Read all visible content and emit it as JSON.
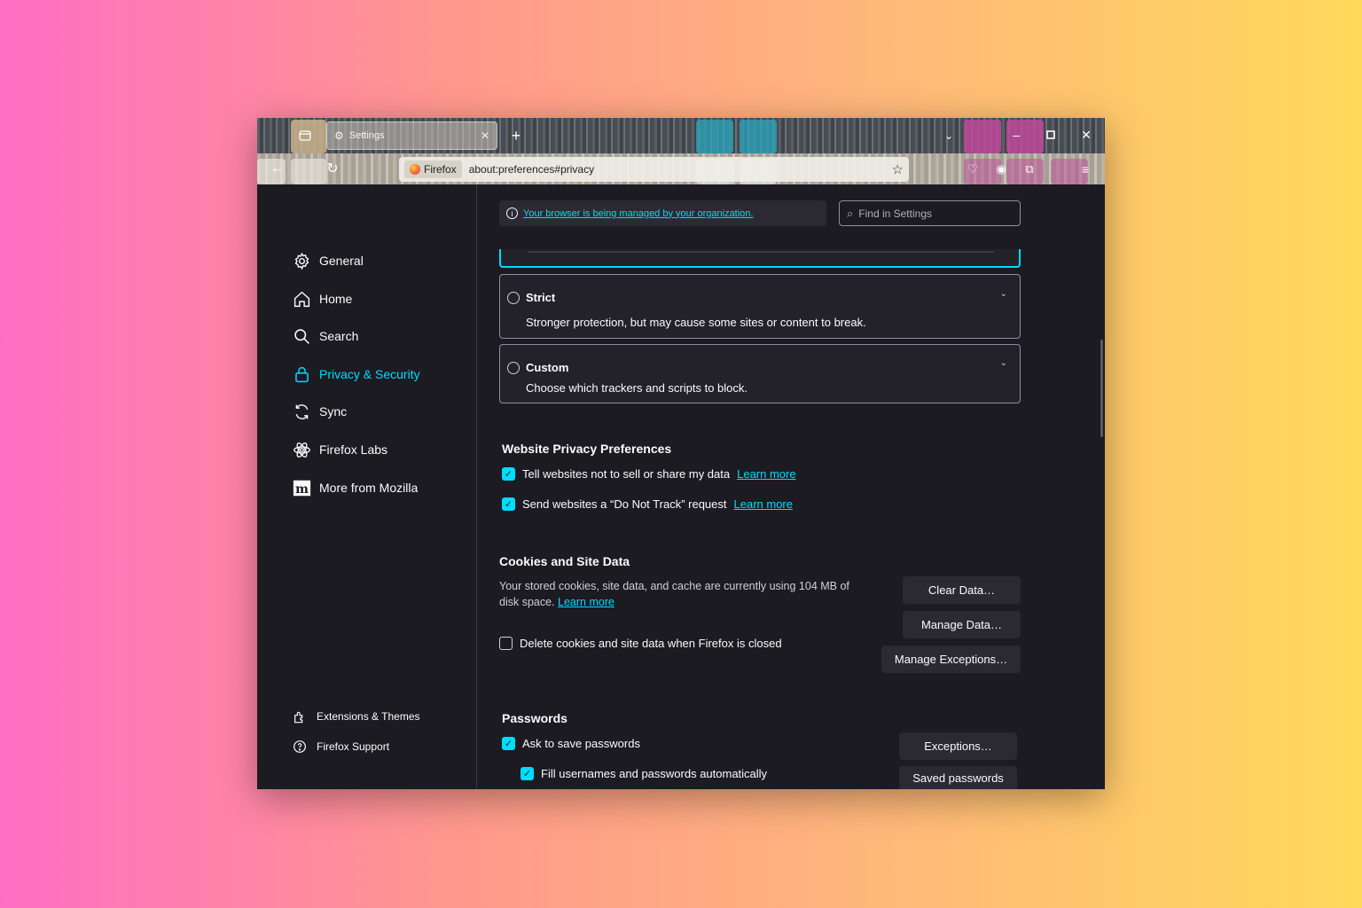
{
  "browser": {
    "tab_title": "Settings",
    "url_identity": "Firefox",
    "url": "about:preferences#privacy",
    "icons": [
      "tab-overview-icon",
      "settings-gear-icon",
      "close-icon",
      "new-tab-icon",
      "list-all-tabs-icon",
      "minimize-icon",
      "maximize-icon",
      "window-close-icon",
      "back-icon",
      "reload-icon",
      "bookmark-star-icon",
      "pocket-icon",
      "account-icon",
      "extensions-icon",
      "menu-icon"
    ]
  },
  "sidebar": {
    "items": [
      {
        "label": "General",
        "icon": "gear-icon"
      },
      {
        "label": "Home",
        "icon": "home-icon"
      },
      {
        "label": "Search",
        "icon": "search-icon"
      },
      {
        "label": "Privacy & Security",
        "icon": "lock-icon",
        "active": true
      },
      {
        "label": "Sync",
        "icon": "sync-icon"
      },
      {
        "label": "Firefox Labs",
        "icon": "labs-icon"
      },
      {
        "label": "More from Mozilla",
        "icon": "mozilla-icon"
      }
    ],
    "footer": [
      {
        "label": "Extensions & Themes",
        "icon": "puzzle-icon"
      },
      {
        "label": "Firefox Support",
        "icon": "help-icon"
      }
    ]
  },
  "main": {
    "managed_notice": "Your browser is being managed by your organization.",
    "find_placeholder": "Find in Settings",
    "tracking_options": [
      {
        "title": "Strict",
        "desc": "Stronger protection, but may cause some sites or content to break.",
        "selected": false
      },
      {
        "title": "Custom",
        "desc": "Choose which trackers and scripts to block.",
        "selected": false
      }
    ],
    "website_privacy": {
      "heading": "Website Privacy Preferences",
      "items": [
        {
          "label": "Tell websites not to sell or share my data",
          "link": "Learn more",
          "checked": true
        },
        {
          "label": "Send websites a “Do Not Track” request",
          "link": "Learn more",
          "checked": true
        }
      ]
    },
    "cookies": {
      "heading": "Cookies and Site Data",
      "desc_line1": "Your stored cookies, site data, and cache are currently using 104 MB of",
      "desc_line2": "disk space.",
      "desc_link": "Learn more",
      "delete_label": "Delete cookies and site data when Firefox is closed",
      "delete_checked": false,
      "buttons": {
        "clear": "Clear Data…",
        "manage": "Manage Data…",
        "exceptions": "Manage Exceptions…"
      }
    },
    "passwords": {
      "heading": "Passwords",
      "ask_label": "Ask to save passwords",
      "ask_checked": true,
      "fill_label": "Fill usernames and passwords automatically",
      "fill_checked": true,
      "buttons": {
        "exceptions": "Exceptions…",
        "saved": "Saved passwords"
      }
    }
  },
  "colors": {
    "accent": "#00ddff",
    "bg": "#1c1b22",
    "panel": "#2b2a33"
  }
}
